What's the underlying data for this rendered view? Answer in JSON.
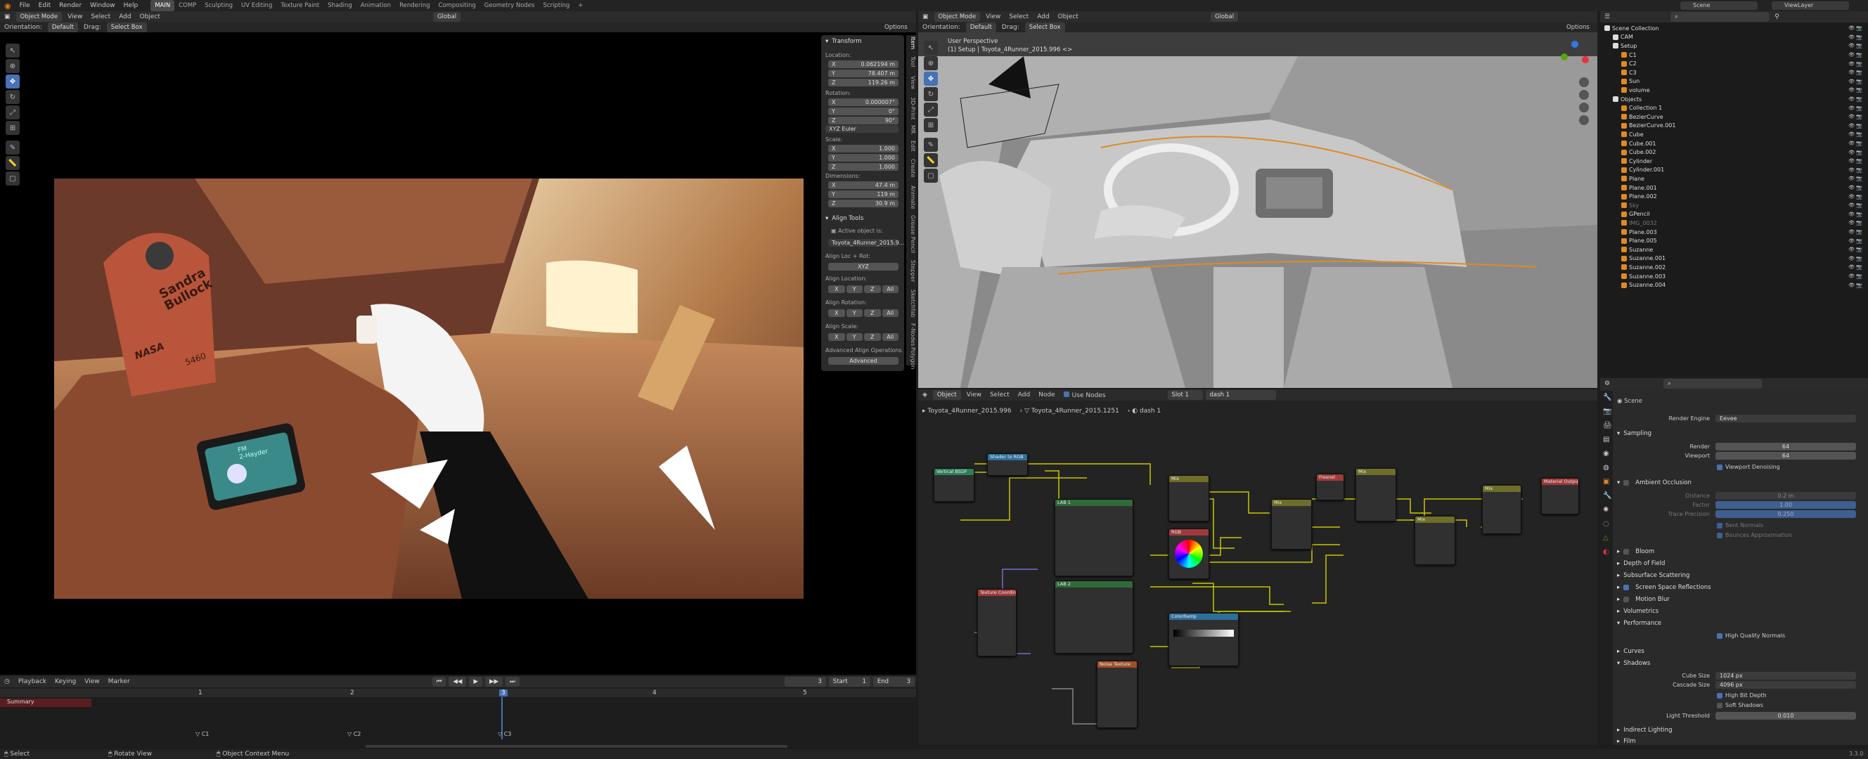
{
  "topbar": {
    "menus": [
      "File",
      "Edit",
      "Render",
      "Window",
      "Help"
    ],
    "workspaces": [
      "MAIN",
      "COMP",
      "Sculpting",
      "UV Editing",
      "Texture Paint",
      "Shading",
      "Animation",
      "Rendering",
      "Compositing",
      "Geometry Nodes",
      "Scripting"
    ],
    "active_workspace": "MAIN",
    "scene": "Scene",
    "view_layer": "ViewLayer"
  },
  "left_view": {
    "mode": "Object Mode",
    "menus": [
      "View",
      "Select",
      "Add",
      "Object"
    ],
    "orientation_label": "Orientation:",
    "orientation": "Default",
    "drag_label": "Drag:",
    "drag": "Select Box",
    "transform_space": "Global",
    "options": "Options",
    "decal_line1": "Sandra",
    "decal_line2": "Bullock",
    "decal_brand": "NASA",
    "decal_num": "5460",
    "screen_text1": "FM",
    "screen_text2": "2-Hayder"
  },
  "npanel": {
    "transform": "Transform",
    "location": "Location:",
    "loc": [
      {
        "a": "X",
        "v": "0.062194 m"
      },
      {
        "a": "Y",
        "v": "78.407 m"
      },
      {
        "a": "Z",
        "v": "119.26 m"
      }
    ],
    "rotation": "Rotation:",
    "rot": [
      {
        "a": "X",
        "v": "0.000007°"
      },
      {
        "a": "Y",
        "v": "0°"
      },
      {
        "a": "Z",
        "v": "90°"
      }
    ],
    "rot_mode": "XYZ Euler",
    "scale": "Scale:",
    "scl": [
      {
        "a": "X",
        "v": "1.000"
      },
      {
        "a": "Y",
        "v": "1.000"
      },
      {
        "a": "Z",
        "v": "1.000"
      }
    ],
    "dimensions": "Dimensions:",
    "dim": [
      {
        "a": "X",
        "v": "47.4 m"
      },
      {
        "a": "Y",
        "v": "119 m"
      },
      {
        "a": "Z",
        "v": "30.9 m"
      }
    ],
    "align_tools": "Align Tools",
    "active_object_is": "Active object is:",
    "active_object": "Toyota_4Runner_2015.9...",
    "align_loc_rot": "Align Loc + Rot:",
    "xyz": "XYZ",
    "align_location": "Align Location:",
    "align_rotation": "Align Rotation:",
    "align_scale": "Align Scale:",
    "axes": [
      "X",
      "Y",
      "Z",
      "All"
    ],
    "advanced_ops": "Advanced Align Operations",
    "advanced": "Advanced",
    "tabs": [
      "Item",
      "Tool",
      "View",
      "3D-Print",
      "MR",
      "Edit",
      "Create",
      "Animate",
      "Grease Pencil",
      "Stepper",
      "Sketchfab",
      "F-Nodes",
      "Polygon"
    ]
  },
  "right_view": {
    "mode": "Object Mode",
    "menus": [
      "View",
      "Select",
      "Add",
      "Object"
    ],
    "orientation_label": "Orientation:",
    "orientation": "Default",
    "drag_label": "Drag:",
    "drag": "Select Box",
    "transform_space": "Global",
    "options": "Options",
    "perspective": "User Perspective",
    "collection": "(1) Setup | Toyota_4Runner_2015.996 <>"
  },
  "timeline": {
    "menus": [
      "Playback",
      "Keying",
      "View",
      "Marker"
    ],
    "current_frame": "3",
    "start_label": "Start",
    "start": "1",
    "end_label": "End",
    "end": "3",
    "ruler": [
      "1",
      "2",
      "3",
      "4",
      "5"
    ],
    "summary": "Summary",
    "markers": [
      "C1",
      "C2",
      "C3"
    ]
  },
  "node_editor": {
    "type": "Object",
    "menus": [
      "View",
      "Select",
      "Add",
      "Node"
    ],
    "use_nodes": "Use Nodes",
    "slot": "Slot 1",
    "material": "dash 1",
    "breadcrumb": [
      "Toyota_4Runner_2015.996",
      "Toyota_4Runner_2015.1251",
      "dash 1"
    ],
    "nodes": [
      {
        "title": "Vertical BSDF",
        "color": "#2e7d5b"
      },
      {
        "title": "Shader to RGB",
        "color": "#2e6f9a"
      },
      {
        "title": "LAB 1",
        "color": "#2f6b3a"
      },
      {
        "title": "Mix",
        "color": "#6e6e2a"
      },
      {
        "title": "Mix",
        "color": "#6e6e2a"
      },
      {
        "title": "Mix",
        "color": "#6e6e2a"
      },
      {
        "title": "Fresnel",
        "color": "#a03a3a"
      },
      {
        "title": "Mix",
        "color": "#6e6e2a"
      },
      {
        "title": "Mix",
        "color": "#6e6e2a"
      },
      {
        "title": "Material Output",
        "color": "#a03a3a"
      },
      {
        "title": "RGB",
        "color": "#a03a3a"
      },
      {
        "title": "LAB 2",
        "color": "#2f6b3a"
      },
      {
        "title": "Texture Coordinate",
        "color": "#a03a3a"
      },
      {
        "title": "ColorRamp",
        "color": "#2e6f9a"
      },
      {
        "title": "Noise Texture",
        "color": "#a0502a"
      }
    ]
  },
  "outliner": {
    "rows": [
      {
        "label": "Scene Collection",
        "depth": 0,
        "color": "#ddd"
      },
      {
        "label": "CAM",
        "depth": 1,
        "color": "#ddd"
      },
      {
        "label": "Setup",
        "depth": 1,
        "color": "#ddd"
      },
      {
        "label": "C1",
        "depth": 2,
        "color": "#ddd"
      },
      {
        "label": "C2",
        "depth": 2,
        "color": "#ddd"
      },
      {
        "label": "C3",
        "depth": 2,
        "color": "#ddd"
      },
      {
        "label": "Sun",
        "depth": 2,
        "color": "#ddd"
      },
      {
        "label": "volume",
        "depth": 2,
        "color": "#ddd"
      },
      {
        "label": "Objects",
        "depth": 1,
        "color": "#ddd"
      },
      {
        "label": "Collection 1",
        "depth": 2,
        "color": "#ddd"
      },
      {
        "label": "BezierCurve",
        "depth": 2,
        "color": "#ddd"
      },
      {
        "label": "BezierCurve.001",
        "depth": 2,
        "color": "#ddd"
      },
      {
        "label": "Cube",
        "depth": 2,
        "color": "#ddd"
      },
      {
        "label": "Cube.001",
        "depth": 2,
        "color": "#ddd"
      },
      {
        "label": "Cube.002",
        "depth": 2,
        "color": "#ddd"
      },
      {
        "label": "Cylinder",
        "depth": 2,
        "color": "#ddd"
      },
      {
        "label": "Cylinder.001",
        "depth": 2,
        "color": "#ddd"
      },
      {
        "label": "Plane",
        "depth": 2,
        "color": "#ddd"
      },
      {
        "label": "Plane.001",
        "depth": 2,
        "color": "#ddd"
      },
      {
        "label": "Plane.002",
        "depth": 2,
        "color": "#ddd"
      },
      {
        "label": "Sky",
        "depth": 2,
        "color": "#777"
      },
      {
        "label": "GPencil",
        "depth": 2,
        "color": "#ddd"
      },
      {
        "label": "IMG_0032",
        "depth": 2,
        "color": "#777"
      },
      {
        "label": "Plane.003",
        "depth": 2,
        "color": "#ddd"
      },
      {
        "label": "Plane.005",
        "depth": 2,
        "color": "#ddd"
      },
      {
        "label": "Suzanne",
        "depth": 2,
        "color": "#ddd"
      },
      {
        "label": "Suzanne.001",
        "depth": 2,
        "color": "#ddd"
      },
      {
        "label": "Suzanne.002",
        "depth": 2,
        "color": "#ddd"
      },
      {
        "label": "Suzanne.003",
        "depth": 2,
        "color": "#ddd"
      },
      {
        "label": "Suzanne.004",
        "depth": 2,
        "color": "#ddd"
      }
    ]
  },
  "properties": {
    "context": "Scene",
    "render_engine_label": "Render Engine",
    "render_engine": "Eevee",
    "sampling": "Sampling",
    "render_label": "Render",
    "render_samples": "64",
    "viewport_label": "Viewport",
    "viewport_samples": "64",
    "viewport_denoising": "Viewport Denoising",
    "ambient_occlusion": "Ambient Occlusion",
    "distance_label": "Distance",
    "distance": "0.2 m",
    "factor_label": "Factor",
    "factor": "1.00",
    "trace_precision_label": "Trace Precision",
    "trace_precision": "0.250",
    "bent_normals": "Bent Normals",
    "bounces_approx": "Bounces Approximation",
    "bloom": "Bloom",
    "dof": "Depth of Field",
    "sss": "Subsurface Scattering",
    "ssr": "Screen Space Reflections",
    "motion_blur": "Motion Blur",
    "volumetrics": "Volumetrics",
    "performance": "Performance",
    "high_quality_normals": "High Quality Normals",
    "curves": "Curves",
    "shadows": "Shadows",
    "cube_size_label": "Cube Size",
    "cube_size": "1024 px",
    "cascade_size_label": "Cascade Size",
    "cascade_size": "4096 px",
    "high_bit_depth": "High Bit Depth",
    "soft_shadows": "Soft Shadows",
    "light_threshold_label": "Light Threshold",
    "light_threshold": "0.010",
    "indirect_lighting": "Indirect Lighting",
    "film": "Film"
  },
  "statusbar": {
    "select": "Select",
    "rotate": "Rotate View",
    "context_menu": "Object Context Menu",
    "version": "3.3.0"
  }
}
